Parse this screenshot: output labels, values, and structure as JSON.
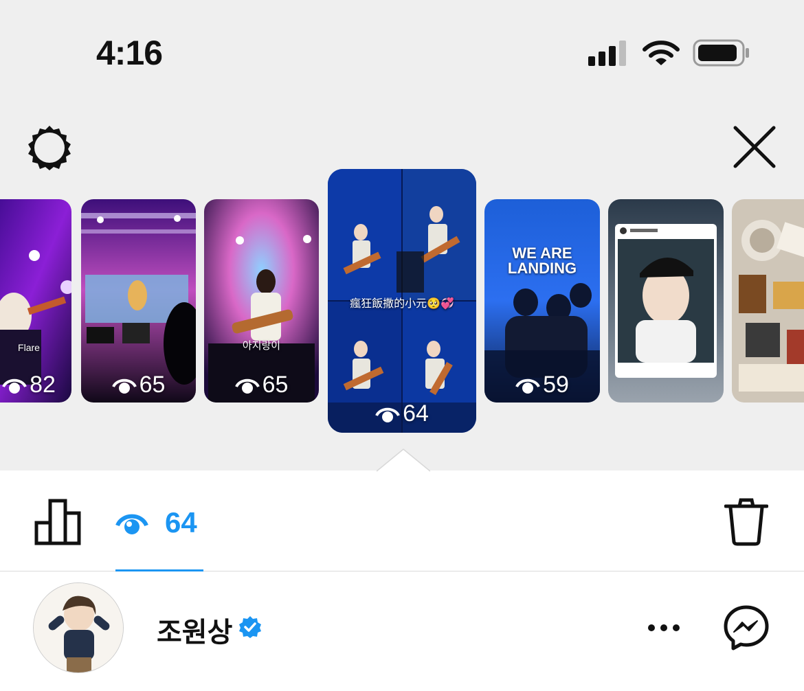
{
  "status_bar": {
    "time": "4:16"
  },
  "header": {
    "settings_icon": "gear-icon",
    "close_icon": "close-icon"
  },
  "stories": [
    {
      "views": "82",
      "caption": "Flare"
    },
    {
      "views": "65",
      "caption": ""
    },
    {
      "views": "65",
      "caption": "아지랑이"
    },
    {
      "views": "64",
      "caption": "瘋狂飯撒的小元🥺💞",
      "selected": true
    },
    {
      "views": "59",
      "caption": "WE ARE LANDING"
    },
    {
      "views": "",
      "caption": ""
    },
    {
      "views": "",
      "caption": ""
    }
  ],
  "toolbar": {
    "viewers_count": "64",
    "active_tab": "viewers"
  },
  "viewers": [
    {
      "name": "조원상",
      "verified": true
    }
  ],
  "colors": {
    "accent": "#1b95f2",
    "top_bg": "#efefef"
  }
}
